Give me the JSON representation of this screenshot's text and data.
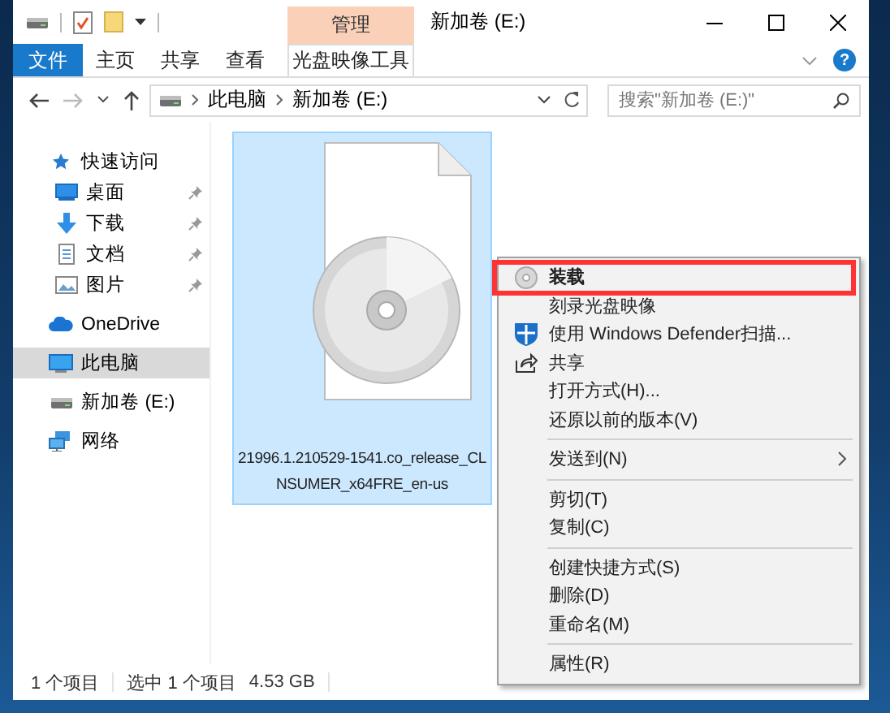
{
  "title_bar": {
    "context_group": "管理",
    "title": "新加卷 (E:)"
  },
  "ribbon": {
    "tabs": [
      {
        "label": "文件",
        "kind": "file"
      },
      {
        "label": "主页",
        "kind": "normal"
      },
      {
        "label": "共享",
        "kind": "normal"
      },
      {
        "label": "查看",
        "kind": "normal"
      },
      {
        "label": "光盘映像工具",
        "kind": "context"
      }
    ],
    "help": "?"
  },
  "address_bar": {
    "path": [
      "此电脑",
      "新加卷 (E:)"
    ]
  },
  "search": {
    "placeholder": "搜索\"新加卷 (E:)\""
  },
  "sidebar": {
    "items": [
      {
        "label": "快速访问",
        "selected": false,
        "children": [
          {
            "label": "桌面",
            "pinned": true,
            "selected": false
          },
          {
            "label": "下载",
            "pinned": true,
            "selected": false
          },
          {
            "label": "文档",
            "pinned": true,
            "selected": false
          },
          {
            "label": "图片",
            "pinned": true,
            "selected": false
          }
        ]
      },
      {
        "label": "OneDrive",
        "selected": false
      },
      {
        "label": "此电脑",
        "selected": true
      },
      {
        "label": "新加卷 (E:)",
        "selected": false
      },
      {
        "label": "网络",
        "selected": false
      }
    ]
  },
  "files": [
    {
      "name": "21996.1.210529-1541.co_release_CL\nNSUMER_x64FRE_en-us",
      "selected": true
    }
  ],
  "context_menu": [
    {
      "kind": "item",
      "label": "装载",
      "default": true,
      "selected": true
    },
    {
      "kind": "item",
      "label": "刻录光盘映像",
      "default": false,
      "selected": false
    },
    {
      "kind": "item",
      "label": "使用 Windows Defender扫描...",
      "default": false,
      "selected": false
    },
    {
      "kind": "item",
      "label": "共享",
      "default": false,
      "selected": false
    },
    {
      "kind": "item",
      "label": "打开方式(H)...",
      "default": false,
      "selected": false
    },
    {
      "kind": "item",
      "label": "还原以前的版本(V)",
      "default": false,
      "selected": false
    },
    {
      "kind": "separator"
    },
    {
      "kind": "item",
      "label": "发送到(N)",
      "default": false,
      "selected": false,
      "submenu": true
    },
    {
      "kind": "separator"
    },
    {
      "kind": "item",
      "label": "剪切(T)",
      "default": false,
      "selected": false
    },
    {
      "kind": "item",
      "label": "复制(C)",
      "default": false,
      "selected": false
    },
    {
      "kind": "separator"
    },
    {
      "kind": "item",
      "label": "创建快捷方式(S)",
      "default": false,
      "selected": false
    },
    {
      "kind": "item",
      "label": "删除(D)",
      "default": false,
      "selected": false
    },
    {
      "kind": "item",
      "label": "重命名(M)",
      "default": false,
      "selected": false
    },
    {
      "kind": "separator"
    },
    {
      "kind": "item",
      "label": "属性(R)",
      "default": false,
      "selected": false
    }
  ],
  "status_bar": {
    "item_count": "1 个项目",
    "selection": "选中 1 个项目",
    "size": "4.53 GB"
  }
}
